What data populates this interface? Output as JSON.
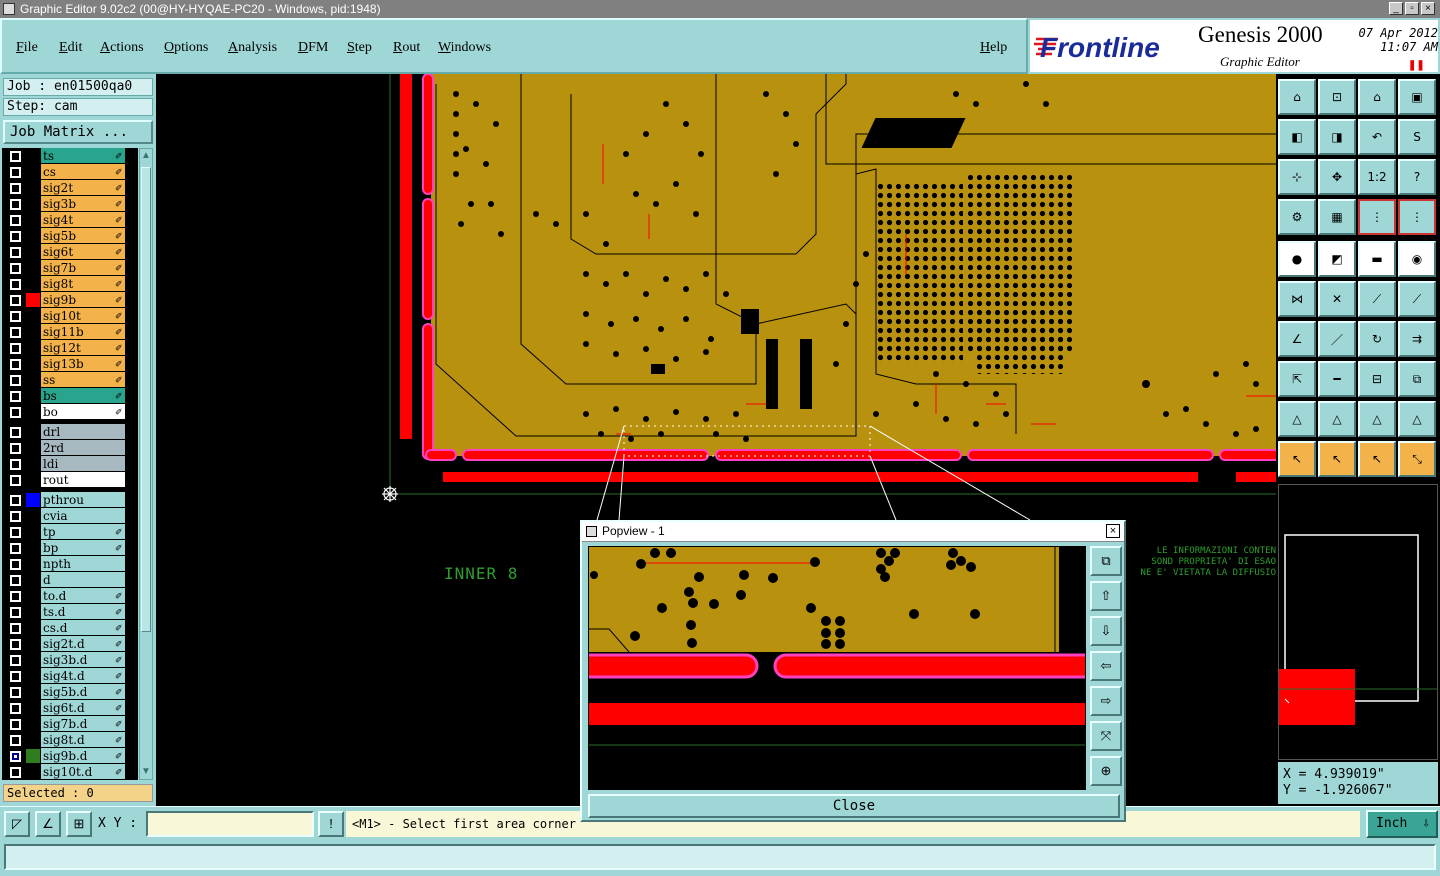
{
  "window": {
    "title": "Graphic Editor 9.02c2 (00@HY-HYQAE-PC20 - Windows, pid:1948)"
  },
  "menu": {
    "items": [
      "File",
      "Edit",
      "Actions",
      "Options",
      "Analysis",
      "DFM",
      "Step",
      "Rout",
      "Windows"
    ],
    "help": "Help"
  },
  "brand": {
    "logo": "Frontline",
    "product": "Genesis 2000",
    "editor": "Graphic Editor",
    "date": "07  Apr 2012",
    "time": "11:07  AM"
  },
  "job": {
    "job_label": "Job : en01500qa0",
    "step_label": "Step: cam",
    "matrix_button": "Job Matrix ..."
  },
  "layers": [
    {
      "name": "ts",
      "bg": "#2aa58d",
      "color": "#000000",
      "checked": false,
      "editable": true
    },
    {
      "name": "cs",
      "bg": "#f3b24a",
      "color": "#000000",
      "checked": false,
      "editable": true
    },
    {
      "name": "sig2t",
      "bg": "#f3b24a",
      "color": "#000000",
      "checked": false,
      "editable": true
    },
    {
      "name": "sig3b",
      "bg": "#f3b24a",
      "color": "#000000",
      "checked": false,
      "editable": true
    },
    {
      "name": "sig4t",
      "bg": "#f3b24a",
      "color": "#000000",
      "checked": false,
      "editable": true
    },
    {
      "name": "sig5b",
      "bg": "#f3b24a",
      "color": "#000000",
      "checked": false,
      "editable": true
    },
    {
      "name": "sig6t",
      "bg": "#f3b24a",
      "color": "#000000",
      "checked": false,
      "editable": true
    },
    {
      "name": "sig7b",
      "bg": "#f3b24a",
      "color": "#000000",
      "checked": false,
      "editable": true
    },
    {
      "name": "sig8t",
      "bg": "#f3b24a",
      "color": "#000000",
      "checked": false,
      "editable": true
    },
    {
      "name": "sig9b",
      "bg": "#f3b24a",
      "color": "#ff0000",
      "checked": false,
      "editable": true
    },
    {
      "name": "sig10t",
      "bg": "#f3b24a",
      "color": "#000000",
      "checked": false,
      "editable": true
    },
    {
      "name": "sig11b",
      "bg": "#f3b24a",
      "color": "#000000",
      "checked": false,
      "editable": true
    },
    {
      "name": "sig12t",
      "bg": "#f3b24a",
      "color": "#000000",
      "checked": false,
      "editable": true
    },
    {
      "name": "sig13b",
      "bg": "#f3b24a",
      "color": "#000000",
      "checked": false,
      "editable": true
    },
    {
      "name": "ss",
      "bg": "#f3b24a",
      "color": "#000000",
      "checked": false,
      "editable": true
    },
    {
      "name": "bs",
      "bg": "#2aa58d",
      "color": "#000000",
      "checked": false,
      "editable": true
    },
    {
      "name": "bo",
      "bg": "#ffffff",
      "color": "#000000",
      "checked": false,
      "editable": true
    },
    {
      "name": "drl",
      "bg": "#a8b8c0",
      "color": "#000000",
      "checked": false,
      "editable": false,
      "gap": true
    },
    {
      "name": "2rd",
      "bg": "#a8b8c0",
      "color": "#000000",
      "checked": false,
      "editable": false
    },
    {
      "name": "ldi",
      "bg": "#a8b8c0",
      "color": "#000000",
      "checked": false,
      "editable": false
    },
    {
      "name": "rout",
      "bg": "#ffffff",
      "color": "#000000",
      "checked": false,
      "editable": false
    },
    {
      "name": "pthrou",
      "bg": "#9fd6d6",
      "color": "#0000ff",
      "checked": false,
      "editable": false,
      "gap": true
    },
    {
      "name": "cvia",
      "bg": "#9fd6d6",
      "color": "#000000",
      "checked": false,
      "editable": false
    },
    {
      "name": "tp",
      "bg": "#9fd6d6",
      "color": "#000000",
      "checked": false,
      "editable": true
    },
    {
      "name": "bp",
      "bg": "#9fd6d6",
      "color": "#000000",
      "checked": false,
      "editable": true
    },
    {
      "name": "npth",
      "bg": "#9fd6d6",
      "color": "#000000",
      "checked": false,
      "editable": false
    },
    {
      "name": "d",
      "bg": "#9fd6d6",
      "color": "#000000",
      "checked": false,
      "editable": false
    },
    {
      "name": "to.d",
      "bg": "#9fd6d6",
      "color": "#000000",
      "checked": false,
      "editable": true
    },
    {
      "name": "ts.d",
      "bg": "#9fd6d6",
      "color": "#000000",
      "checked": false,
      "editable": true
    },
    {
      "name": "cs.d",
      "bg": "#9fd6d6",
      "color": "#000000",
      "checked": false,
      "editable": true
    },
    {
      "name": "sig2t.d",
      "bg": "#9fd6d6",
      "color": "#000000",
      "checked": false,
      "editable": true
    },
    {
      "name": "sig3b.d",
      "bg": "#9fd6d6",
      "color": "#000000",
      "checked": false,
      "editable": true
    },
    {
      "name": "sig4t.d",
      "bg": "#9fd6d6",
      "color": "#000000",
      "checked": false,
      "editable": true
    },
    {
      "name": "sig5b.d",
      "bg": "#9fd6d6",
      "color": "#000000",
      "checked": false,
      "editable": true
    },
    {
      "name": "sig6t.d",
      "bg": "#9fd6d6",
      "color": "#000000",
      "checked": false,
      "editable": true
    },
    {
      "name": "sig7b.d",
      "bg": "#9fd6d6",
      "color": "#000000",
      "checked": false,
      "editable": true
    },
    {
      "name": "sig8t.d",
      "bg": "#9fd6d6",
      "color": "#000000",
      "checked": false,
      "editable": true
    },
    {
      "name": "sig9b.d",
      "bg": "#9fd6d6",
      "color": "#2e7d1e",
      "checked": true,
      "editable": true
    },
    {
      "name": "sig10t.d",
      "bg": "#9fd6d6",
      "color": "#000000",
      "checked": false,
      "editable": true
    }
  ],
  "selected": "Selected : 0",
  "canvas": {
    "layer_label": "INNER 8",
    "notice": [
      "LE INFORMAZIONI CONTEN",
      "SOND PROPRIETA' DI ESAO",
      "NE E' VIETATA LA DIFFUSIO"
    ]
  },
  "popview": {
    "title": "Popview - 1",
    "close": "Close"
  },
  "coords": {
    "x": "X = 4.939019\"",
    "y": "Y = -1.926067\""
  },
  "status": {
    "xy_label": "X Y :",
    "xy_value": "",
    "message": "<M1> - Select first area corner",
    "unit": "Inch"
  },
  "colors": {
    "panel": "#9fd6d6",
    "board": "#b8920e",
    "copper": "#ff0000",
    "accent_pink": "#ff40c0"
  }
}
